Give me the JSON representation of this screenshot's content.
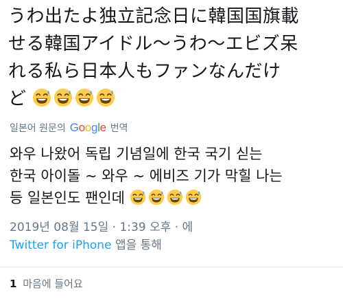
{
  "tweet": {
    "original_text_line1": "うわ出たよ独立記念日に韓国国旗載",
    "original_text_line2": "せる韓国アイドル〜うわ〜エビズ呆",
    "original_text_line3": "れる私ら日本人もファンなんだけ",
    "original_text_line4": "ど",
    "translate_label_prefix": "일본어 원문의",
    "translate_label_suffix": "번역",
    "google_letters": [
      "G",
      "o",
      "o",
      "g",
      "l",
      "e"
    ],
    "translated_line1": "와우 나왔어 독립 기념일에 한국 국기 싣는",
    "translated_line2": "한국 아이돌 ~ 와우 ~ 에비즈 기가 막힐 나는",
    "translated_line3": "등 일본인도 팬인데",
    "timestamp": "2019년 08월 15일 · 1:39 오후 · 에",
    "source_app": "Twitter for iPhone",
    "source_suffix": " 앱을 통해",
    "likes_count": "1",
    "likes_label": "마음에 들어요"
  },
  "icons": {
    "emoji": "grinning-face-with-sweat-icon"
  },
  "colors": {
    "text_primary": "#14171a",
    "text_secondary": "#657786",
    "link": "#1da1f2",
    "divider": "#e6ecf0"
  }
}
